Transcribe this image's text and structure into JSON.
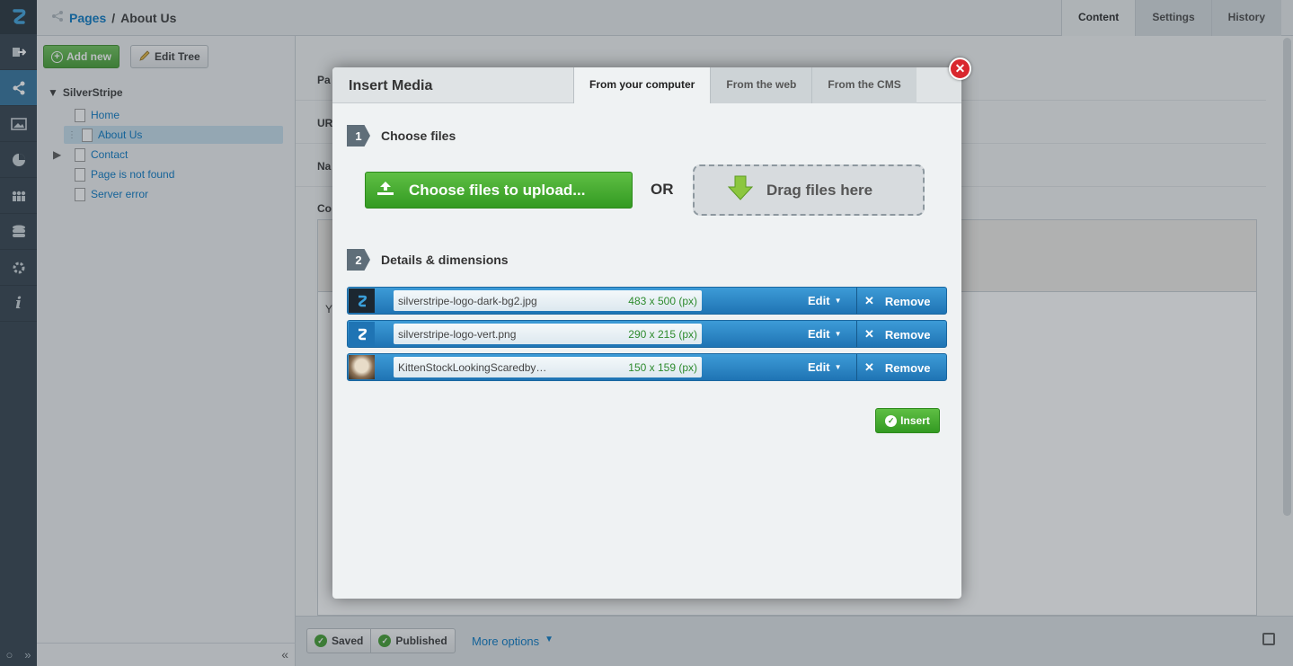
{
  "header": {
    "breadcrumb_parent": "Pages",
    "breadcrumb_separator": "/",
    "breadcrumb_current": "About Us",
    "tabs": [
      {
        "label": "Content"
      },
      {
        "label": "Settings"
      },
      {
        "label": "History"
      }
    ]
  },
  "tree": {
    "add_new_label": "Add new",
    "edit_tree_label": "Edit Tree",
    "root_label": "SilverStripe",
    "items": [
      {
        "label": "Home"
      },
      {
        "label": "About Us"
      },
      {
        "label": "Contact"
      },
      {
        "label": "Page is not found"
      },
      {
        "label": "Server error"
      }
    ],
    "collapse_glyph": "«"
  },
  "content_bg": {
    "row_labels": [
      "Pa",
      "UR",
      "Na",
      "Co"
    ],
    "editor_letter": "Y"
  },
  "actions": {
    "saved_label": "Saved",
    "published_label": "Published",
    "more_options_label": "More options"
  },
  "modal": {
    "title": "Insert Media",
    "tabs": [
      {
        "label": "From your computer"
      },
      {
        "label": "From the web"
      },
      {
        "label": "From the CMS"
      }
    ],
    "step1": {
      "num": "1",
      "label": "Choose files"
    },
    "step2": {
      "num": "2",
      "label": "Details & dimensions"
    },
    "choose_button": "Choose files to upload...",
    "or_label": "OR",
    "drop_label": "Drag files here",
    "files": [
      {
        "name": "silverstripe-logo-dark-bg2.jpg",
        "dims": "483 x 500 (px)",
        "edit": "Edit",
        "remove": "Remove"
      },
      {
        "name": "silverstripe-logo-vert.png",
        "dims": "290 x 215 (px)",
        "edit": "Edit",
        "remove": "Remove"
      },
      {
        "name": "KittenStockLookingScaredby…",
        "dims": "150 x 159 (px)",
        "edit": "Edit",
        "remove": "Remove"
      }
    ],
    "insert_label": "Insert"
  },
  "colors": {
    "accent_blue": "#0073c1",
    "green": "#3f9a2c",
    "file_row_blue": "#2a86c6",
    "close_red": "#d9272e"
  },
  "rail_icons": [
    "silverstripe-logo-icon",
    "logout-icon",
    "site-tree-icon",
    "files-icon",
    "reports-icon",
    "security-icon",
    "database-icon",
    "settings-icon",
    "help-icon"
  ]
}
